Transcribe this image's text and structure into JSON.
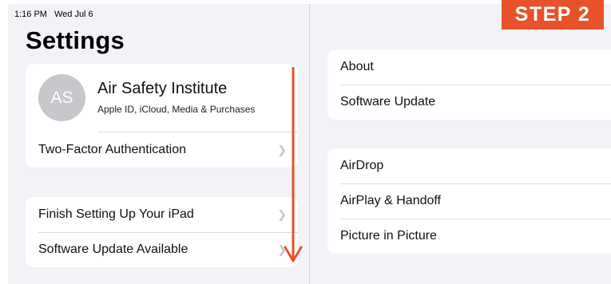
{
  "status_bar": {
    "time": "1:16 PM",
    "date": "Wed Jul 6"
  },
  "page_title": "Settings",
  "profile": {
    "initials": "AS",
    "name": "Air Safety Institute",
    "subtitle": "Apple ID, iCloud, Media & Purchases"
  },
  "left_groups": {
    "account": [
      "Two-Factor Authentication"
    ],
    "setup": [
      "Finish Setting Up Your iPad",
      "Software Update Available"
    ]
  },
  "right_groups": {
    "general": [
      "About",
      "Software Update"
    ],
    "sharing": [
      "AirDrop",
      "AirPlay & Handoff",
      "Picture in Picture"
    ]
  },
  "annotation": {
    "step_label": "STEP 2",
    "accent_color": "#e8522a",
    "arrow_direction": "down"
  },
  "icons": {
    "chevron": "chevron-right-icon",
    "arrow": "arrow-down-icon"
  }
}
